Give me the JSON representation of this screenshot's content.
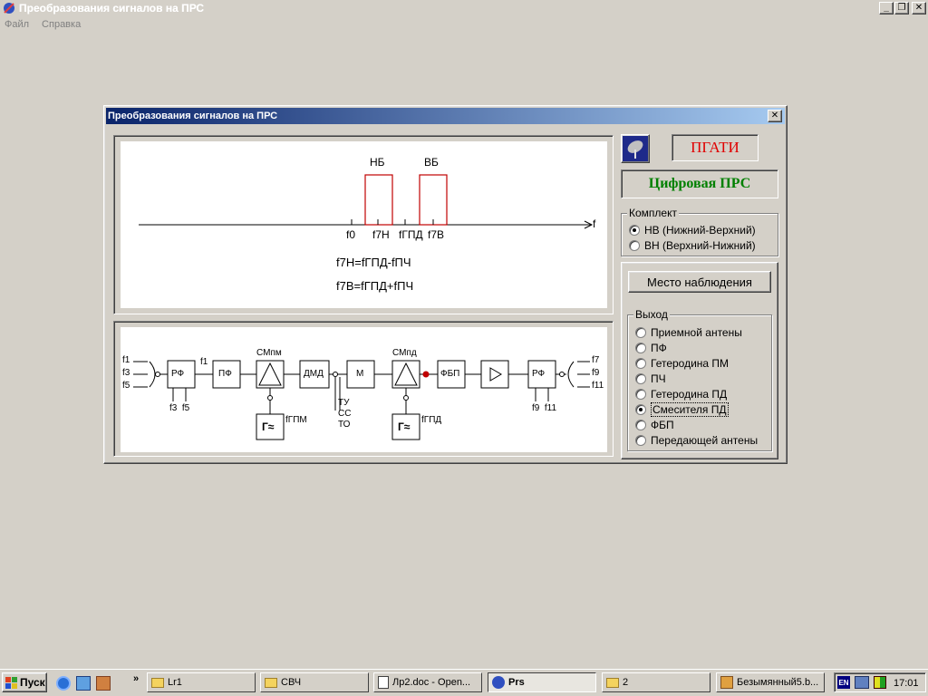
{
  "app": {
    "title": "Преобразования сигналов на ПРС",
    "menu": [
      "Файл",
      "Справка"
    ]
  },
  "dialog": {
    "title": "Преобразования сигналов на ПРС",
    "spectrum": {
      "band_nb": "НБ",
      "band_vb": "ВБ",
      "axis_label": "f",
      "tick_f0": "f0",
      "tick_f7n": "f7Н",
      "tick_fgpd": "fГПД",
      "tick_f7v": "f7В",
      "formula_1": "f7Н=fГПД-fПЧ",
      "formula_2": "f7В=fГПД+fПЧ"
    },
    "block_diagram": {
      "inputs": [
        "f1",
        "f3",
        "f5"
      ],
      "blocks": [
        "РФ",
        "ПФ",
        "СМпм",
        "ДМД",
        "М",
        "СМпд",
        "ФБП",
        "РФ"
      ],
      "after_rf": "f1",
      "rf1_outputs": "f3  f5",
      "generator": "Г≈",
      "gen1_label": "fГПМ",
      "gen2_label": "fГПД",
      "control": [
        "ТУ",
        "СС",
        "ТО"
      ],
      "rf2_inputs": "f9  f11",
      "outputs": [
        "f7",
        "f9",
        "f11"
      ]
    },
    "logo_label": "ПГАТИ",
    "prs_type": "Цифровая ПРС",
    "komplekt": {
      "legend": "Комплект",
      "options": [
        "НВ (Нижний-Верхний)",
        "ВН (Верхний-Нижний)"
      ],
      "selected": "НВ (Нижний-Верхний)"
    },
    "observe_button": "Место наблюдения",
    "output": {
      "legend": "Выход",
      "options": [
        "Приемной антены",
        "ПФ",
        "Гетеродина ПМ",
        "ПЧ",
        "Гетеродина ПД",
        "Смесителя ПД",
        "ФБП",
        "Передающей антены"
      ],
      "selected": "Смесителя ПД"
    }
  },
  "taskbar": {
    "start": "Пуск",
    "buttons": [
      "Lr1",
      "СВЧ",
      "Лр2.doc - Open...",
      "Prs",
      "2",
      "Безымянный5.b..."
    ],
    "active": "Prs",
    "lang": "EN",
    "clock": "17:01"
  },
  "colors": {
    "title_gradient_start": "#0a246a",
    "title_gradient_end": "#a6caf0",
    "band_color": "#c00000",
    "logo_text": "#e00000",
    "prs_text": "#008000"
  }
}
